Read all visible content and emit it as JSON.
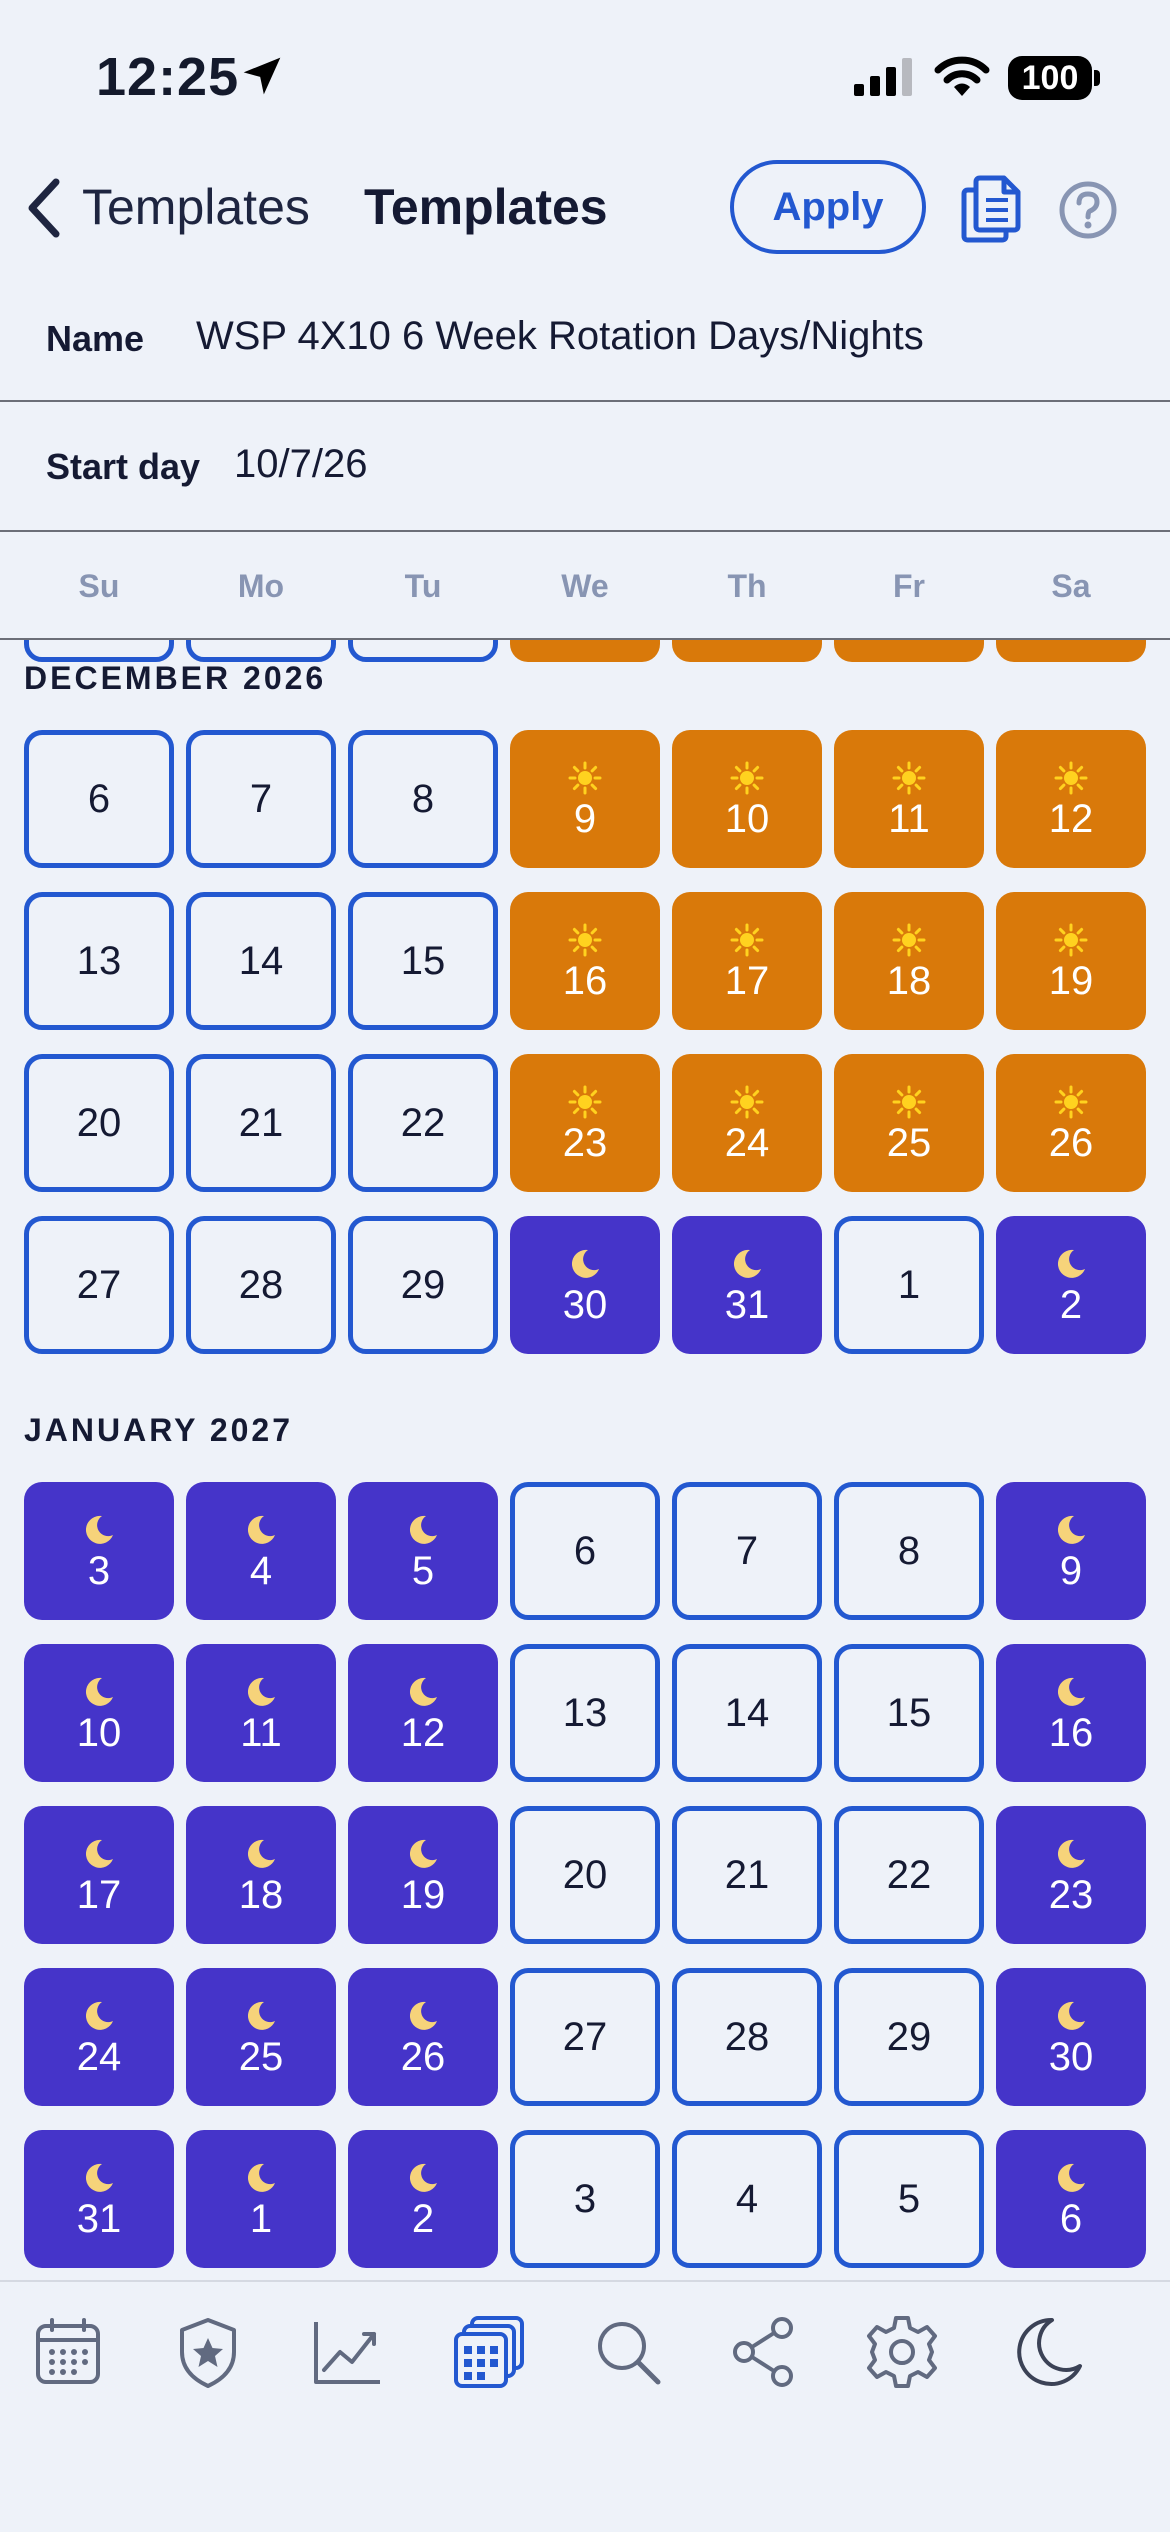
{
  "status": {
    "time": "12:25",
    "battery": "100"
  },
  "nav": {
    "back_label": "Templates",
    "title": "Templates",
    "apply_label": "Apply"
  },
  "form": {
    "name_label": "Name",
    "name_value": "WSP 4X10 6 Week Rotation Days/Nights",
    "start_label": "Start day",
    "start_value": "10/7/26"
  },
  "weekdays": [
    "Su",
    "Mo",
    "Tu",
    "We",
    "Th",
    "Fr",
    "Sa"
  ],
  "colors": {
    "accent": "#2358d0",
    "day_shift": "#d9790a",
    "night_shift": "#4534c9",
    "background": "#eef2f9"
  },
  "calendar": {
    "months": [
      {
        "label": "DECEMBER 2026",
        "weeks": [
          [
            {
              "n": "6",
              "t": "off"
            },
            {
              "n": "7",
              "t": "off"
            },
            {
              "n": "8",
              "t": "off"
            },
            {
              "n": "9",
              "t": "sun"
            },
            {
              "n": "10",
              "t": "sun"
            },
            {
              "n": "11",
              "t": "sun"
            },
            {
              "n": "12",
              "t": "sun"
            }
          ],
          [
            {
              "n": "13",
              "t": "off"
            },
            {
              "n": "14",
              "t": "off"
            },
            {
              "n": "15",
              "t": "off"
            },
            {
              "n": "16",
              "t": "sun"
            },
            {
              "n": "17",
              "t": "sun"
            },
            {
              "n": "18",
              "t": "sun"
            },
            {
              "n": "19",
              "t": "sun"
            }
          ],
          [
            {
              "n": "20",
              "t": "off"
            },
            {
              "n": "21",
              "t": "off"
            },
            {
              "n": "22",
              "t": "off"
            },
            {
              "n": "23",
              "t": "sun"
            },
            {
              "n": "24",
              "t": "sun"
            },
            {
              "n": "25",
              "t": "sun"
            },
            {
              "n": "26",
              "t": "sun"
            }
          ],
          [
            {
              "n": "27",
              "t": "off"
            },
            {
              "n": "28",
              "t": "off"
            },
            {
              "n": "29",
              "t": "off"
            },
            {
              "n": "30",
              "t": "moon"
            },
            {
              "n": "31",
              "t": "moon"
            },
            {
              "n": "1",
              "t": "off"
            },
            {
              "n": "2",
              "t": "moon"
            }
          ]
        ]
      },
      {
        "label": "JANUARY 2027",
        "weeks": [
          [
            {
              "n": "3",
              "t": "moon"
            },
            {
              "n": "4",
              "t": "moon"
            },
            {
              "n": "5",
              "t": "moon"
            },
            {
              "n": "6",
              "t": "off"
            },
            {
              "n": "7",
              "t": "off"
            },
            {
              "n": "8",
              "t": "off"
            },
            {
              "n": "9",
              "t": "moon"
            }
          ],
          [
            {
              "n": "10",
              "t": "moon"
            },
            {
              "n": "11",
              "t": "moon"
            },
            {
              "n": "12",
              "t": "moon"
            },
            {
              "n": "13",
              "t": "off"
            },
            {
              "n": "14",
              "t": "off"
            },
            {
              "n": "15",
              "t": "off"
            },
            {
              "n": "16",
              "t": "moon"
            }
          ],
          [
            {
              "n": "17",
              "t": "moon"
            },
            {
              "n": "18",
              "t": "moon"
            },
            {
              "n": "19",
              "t": "moon"
            },
            {
              "n": "20",
              "t": "off"
            },
            {
              "n": "21",
              "t": "off"
            },
            {
              "n": "22",
              "t": "off"
            },
            {
              "n": "23",
              "t": "moon"
            }
          ],
          [
            {
              "n": "24",
              "t": "moon"
            },
            {
              "n": "25",
              "t": "moon"
            },
            {
              "n": "26",
              "t": "moon"
            },
            {
              "n": "27",
              "t": "off"
            },
            {
              "n": "28",
              "t": "off"
            },
            {
              "n": "29",
              "t": "off"
            },
            {
              "n": "30",
              "t": "moon"
            }
          ],
          [
            {
              "n": "31",
              "t": "moon"
            },
            {
              "n": "1",
              "t": "moon"
            },
            {
              "n": "2",
              "t": "moon"
            },
            {
              "n": "3",
              "t": "off"
            },
            {
              "n": "4",
              "t": "off"
            },
            {
              "n": "5",
              "t": "off"
            },
            {
              "n": "6",
              "t": "moon"
            }
          ]
        ]
      }
    ],
    "partial_top_week": [
      {
        "t": "off"
      },
      {
        "t": "off"
      },
      {
        "t": "off"
      },
      {
        "t": "sun"
      },
      {
        "t": "sun"
      },
      {
        "t": "sun"
      },
      {
        "t": "sun"
      }
    ]
  },
  "tabs": [
    {
      "name": "calendar-icon"
    },
    {
      "name": "shield-star-icon"
    },
    {
      "name": "chart-line-icon"
    },
    {
      "name": "templates-icon",
      "active": true
    },
    {
      "name": "search-icon"
    },
    {
      "name": "share-icon"
    },
    {
      "name": "gear-icon"
    },
    {
      "name": "moon-icon"
    }
  ]
}
